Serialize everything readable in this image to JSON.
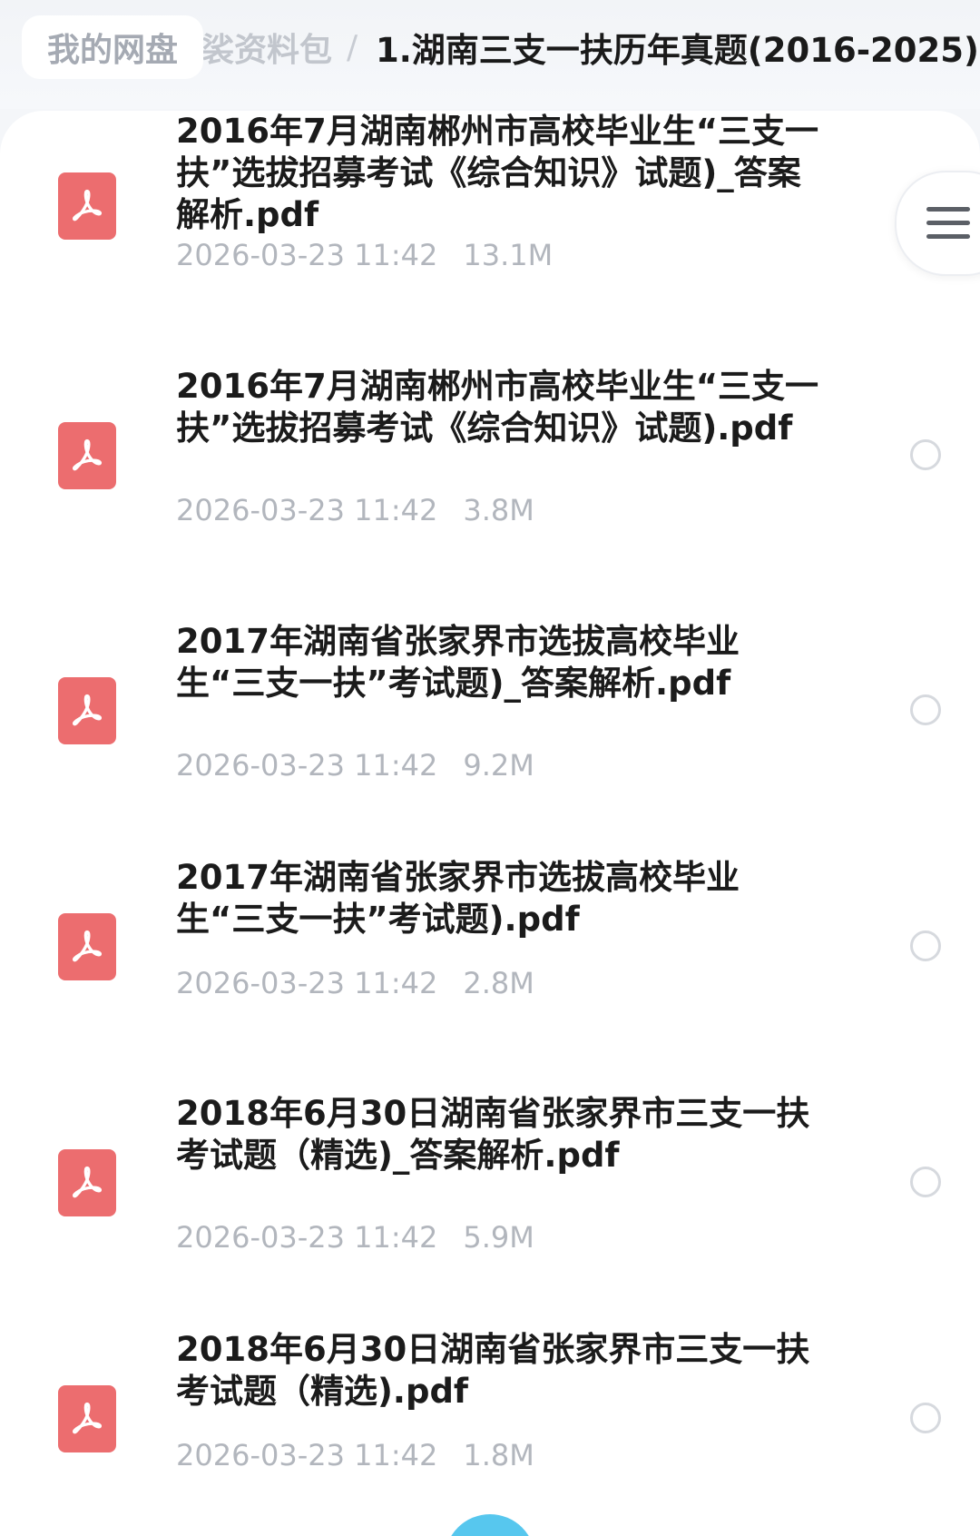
{
  "breadcrumb": {
    "home": "我的网盘",
    "parent": "裟资料包",
    "separator": "/",
    "current": "1.湖南三支一扶历年真题(2016-2025)"
  },
  "files": [
    {
      "name": "2016年7月湖南郴州市高校毕业生“三支一扶”选拔招募考试《综合知识》试题)_答案解析.pdf",
      "date": "2026-03-23 11:42",
      "size": "13.1M",
      "icon": "pdf-icon"
    },
    {
      "name": "2016年7月湖南郴州市高校毕业生“三支一扶”选拔招募考试《综合知识》试题).pdf",
      "date": "2026-03-23 11:42",
      "size": "3.8M",
      "icon": "pdf-icon"
    },
    {
      "name": "2017年湖南省张家界市选拔高校毕业生“三支一扶”考试题)_答案解析.pdf",
      "date": "2026-03-23 11:42",
      "size": "9.2M",
      "icon": "pdf-icon"
    },
    {
      "name": "2017年湖南省张家界市选拔高校毕业生“三支一扶”考试题).pdf",
      "date": "2026-03-23 11:42",
      "size": "2.8M",
      "icon": "pdf-icon"
    },
    {
      "name": "2018年6月30日湖南省张家界市三支一扶考试题（精选)_答案解析.pdf",
      "date": "2026-03-23 11:42",
      "size": "5.9M",
      "icon": "pdf-icon"
    },
    {
      "name": "2018年6月30日湖南省张家界市三支一扶考试题（精选).pdf",
      "date": "2026-03-23 11:42",
      "size": "1.8M",
      "icon": "pdf-icon"
    }
  ],
  "colors": {
    "pdf_icon": "#ec6d6f",
    "meta_text": "#b2b6bd",
    "title_text": "#1b1b1b",
    "fab": "#57c7ee"
  }
}
